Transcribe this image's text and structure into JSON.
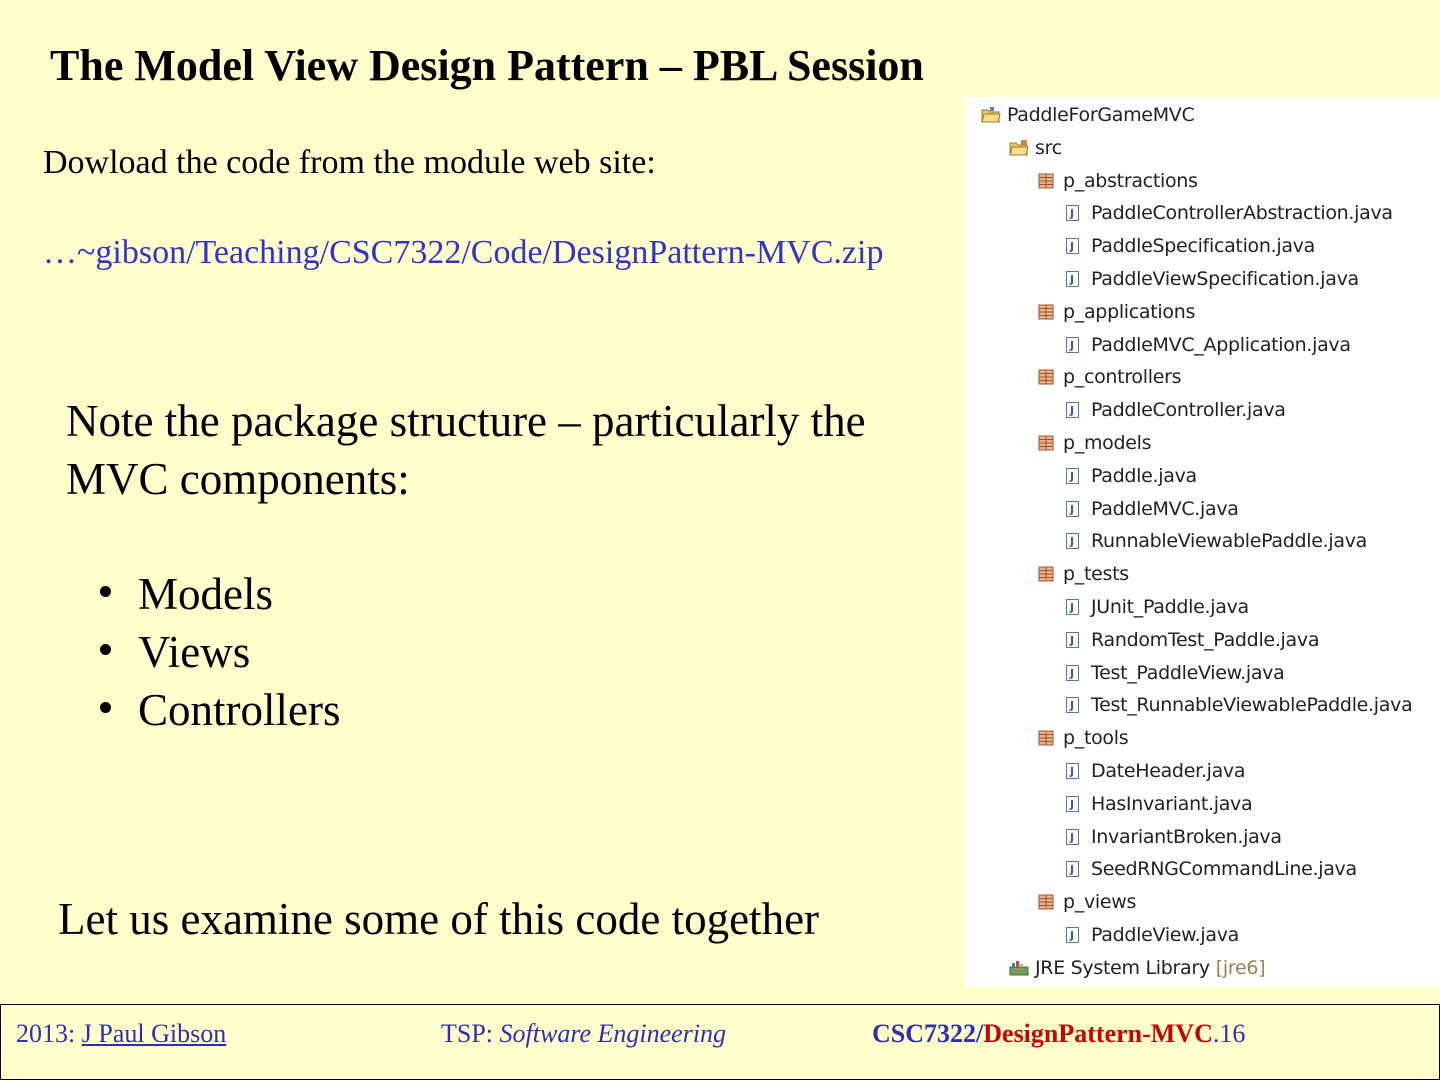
{
  "slide": {
    "title": "The Model View Design Pattern – PBL Session",
    "download_text": "Dowload the code from the module web site:",
    "download_link": "…~gibson/Teaching/CSC7322/Code/DesignPattern-MVC.zip",
    "note_text": "Note the package structure – particularly the MVC components:",
    "bullets": [
      "Models",
      "Views",
      "Controllers"
    ],
    "closing_text": "Let us examine some of this code together"
  },
  "package_tree": {
    "project": "PaddleForGameMVC",
    "src": "src",
    "packages": [
      {
        "name": "p_abstractions",
        "files": [
          "PaddleControllerAbstraction.java",
          "PaddleSpecification.java",
          "PaddleViewSpecification.java"
        ]
      },
      {
        "name": "p_applications",
        "files": [
          "PaddleMVC_Application.java"
        ]
      },
      {
        "name": "p_controllers",
        "files": [
          "PaddleController.java"
        ]
      },
      {
        "name": "p_models",
        "files": [
          "Paddle.java",
          "PaddleMVC.java",
          "RunnableViewablePaddle.java"
        ]
      },
      {
        "name": "p_tests",
        "files": [
          "JUnit_Paddle.java",
          "RandomTest_Paddle.java",
          "Test_PaddleView.java",
          "Test_RunnableViewablePaddle.java"
        ]
      },
      {
        "name": "p_tools",
        "files": [
          "DateHeader.java",
          "HasInvariant.java",
          "InvariantBroken.java",
          "SeedRNGCommandLine.java"
        ]
      },
      {
        "name": "p_views",
        "files": [
          "PaddleView.java"
        ]
      }
    ],
    "library": "JRE System Library",
    "library_suffix": "[jre6]"
  },
  "footer": {
    "year_prefix": "2013: ",
    "author": "J Paul Gibson",
    "tsp_prefix": "TSP: ",
    "tsp_subject": "Software Engineering",
    "course": "CSC7322/",
    "topic": "DesignPattern-MVC",
    "page_suffix": ".16"
  },
  "colors": {
    "background": "#FFFFCC",
    "link": "#3333CC",
    "topic": "#CC0000"
  }
}
